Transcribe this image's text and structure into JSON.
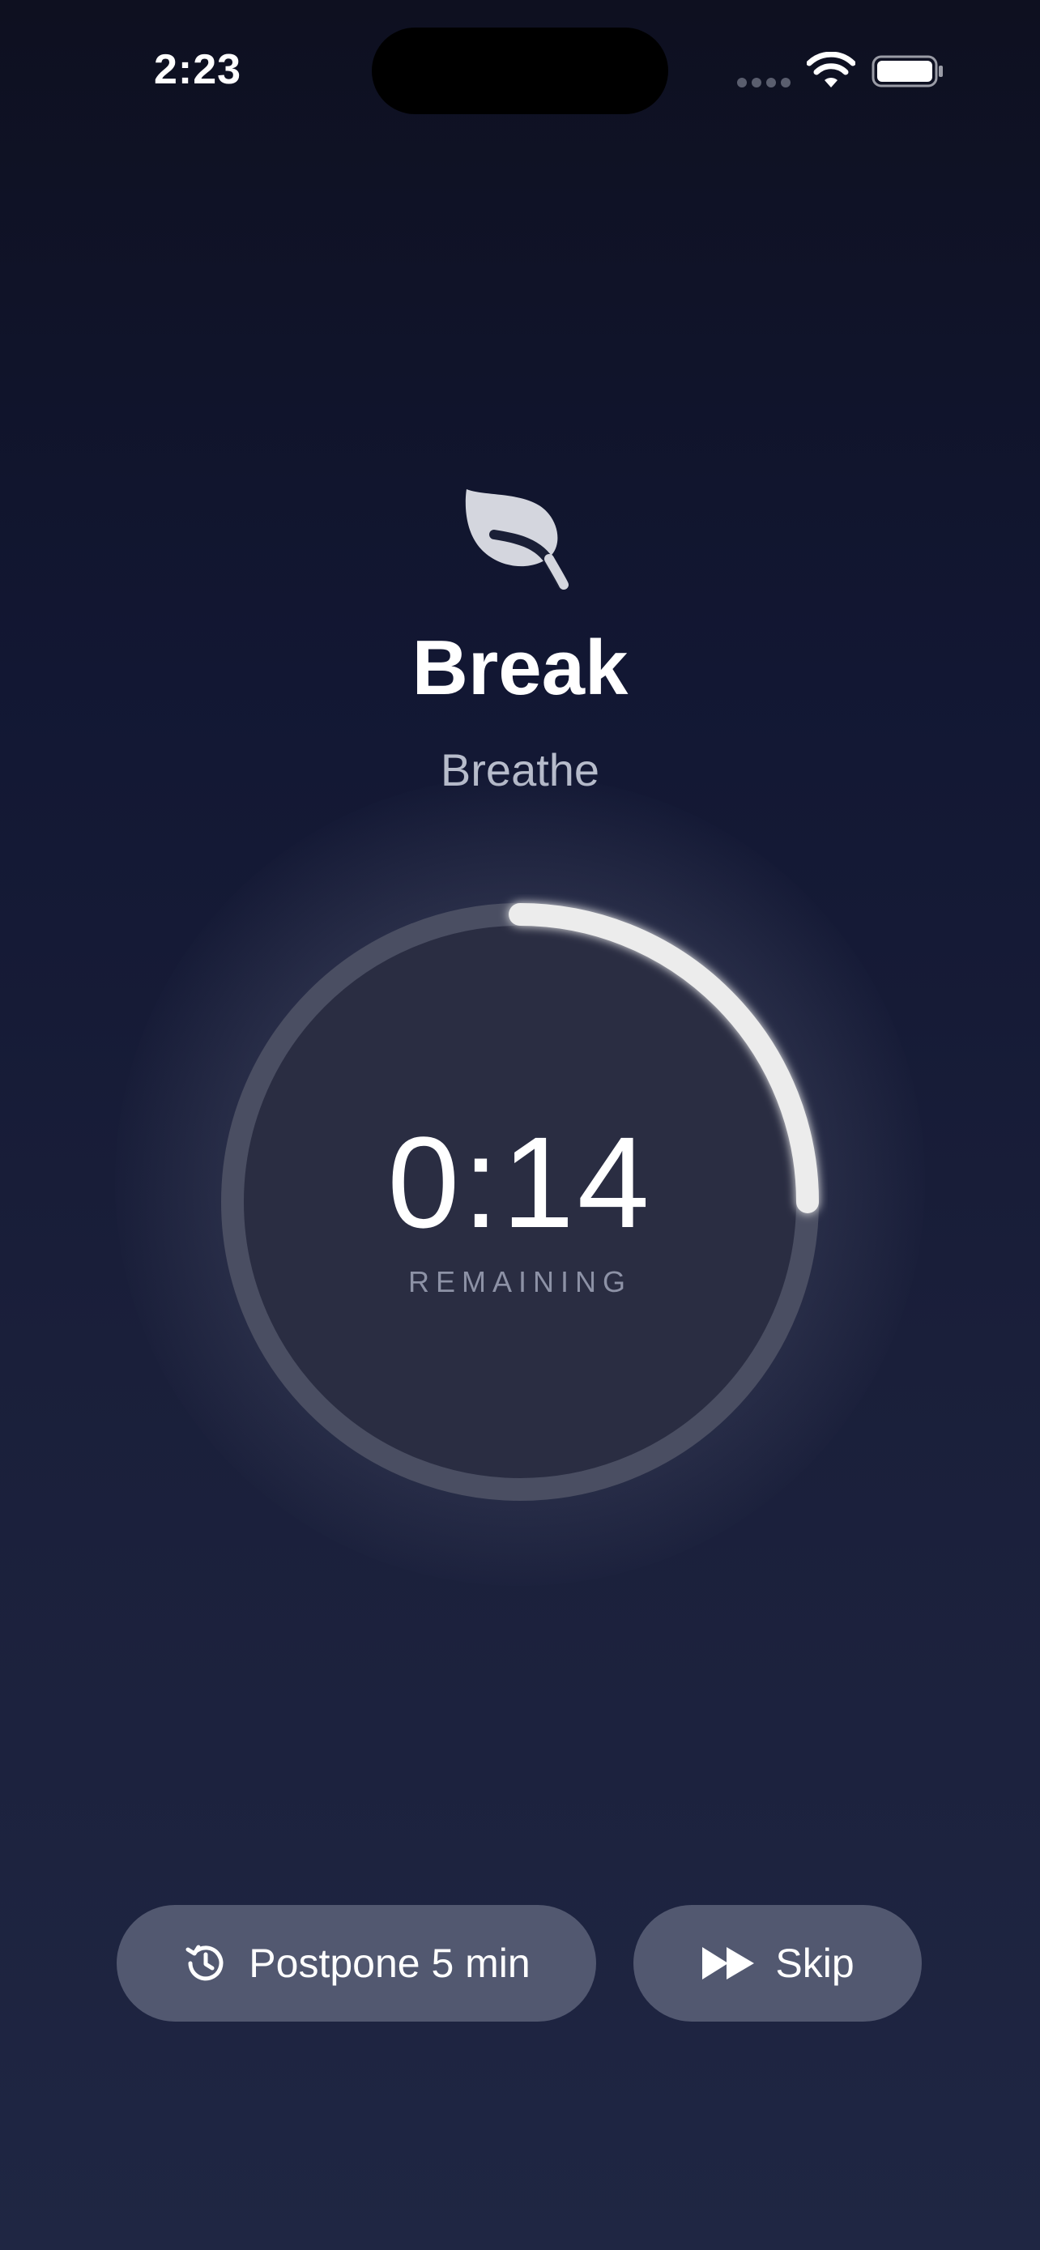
{
  "status_bar": {
    "time": "2:23"
  },
  "break_screen": {
    "title": "Break",
    "subtitle": "Breathe",
    "timer_value": "0:14",
    "timer_caption": "REMAINING",
    "progress_fraction": 0.25
  },
  "actions": {
    "postpone_label": "Postpone 5 min",
    "skip_label": "Skip"
  },
  "colors": {
    "background_top": "#0e1020",
    "background_bottom": "#1f2643",
    "button_bg": "#525870",
    "ring_track": "#4a4e62",
    "ring_progress": "#ececec"
  },
  "icons": {
    "leaf": "leaf-icon",
    "postpone": "clock-history-icon",
    "skip": "fast-forward-icon"
  }
}
